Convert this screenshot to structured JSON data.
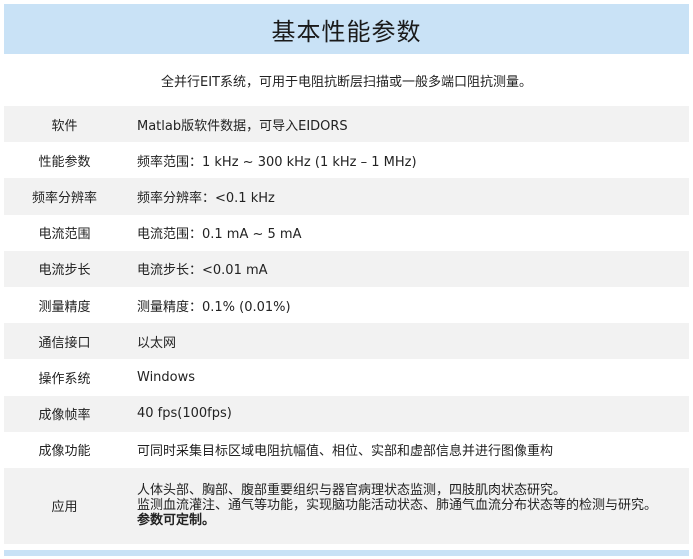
{
  "title": "基本性能参数",
  "intro": "全并行EIT系统，可用于电阻抗断层扫描或一般多端口阻抗测量。",
  "rows": [
    {
      "label": "软件",
      "value": "Matlab版软件数据，可导入EIDORS"
    },
    {
      "label": "性能参数",
      "value": "频率范围：1 kHz ~ 300 kHz (1 kHz – 1 MHz)"
    },
    {
      "label": "频率分辨率",
      "value": "频率分辨率：<0.1 kHz"
    },
    {
      "label": "电流范围",
      "value": "电流范围：0.1 mA ~ 5 mA"
    },
    {
      "label": "电流步长",
      "value": "电流步长：<0.01 mA"
    },
    {
      "label": "测量精度",
      "value": "测量精度：0.1% (0.01%)"
    },
    {
      "label": "通信接口",
      "value": "以太网"
    },
    {
      "label": "操作系统",
      "value": "Windows"
    },
    {
      "label": "成像帧率",
      "value": "40 fps(100fps)"
    },
    {
      "label": "成像功能",
      "value": "可同时采集目标区域电阻抗幅值、相位、实部和虚部信息并进行图像重构"
    }
  ],
  "application": {
    "label": "应用",
    "lines": [
      "人体头部、胸部、腹部重要组织与器官病理状态监测，四肢肌肉状态研究。",
      "监测血流灌注、通气等功能，实现脑功能活动状态、肺通气血流分布状态等的检测与研究。"
    ],
    "note": "参数可定制。"
  }
}
